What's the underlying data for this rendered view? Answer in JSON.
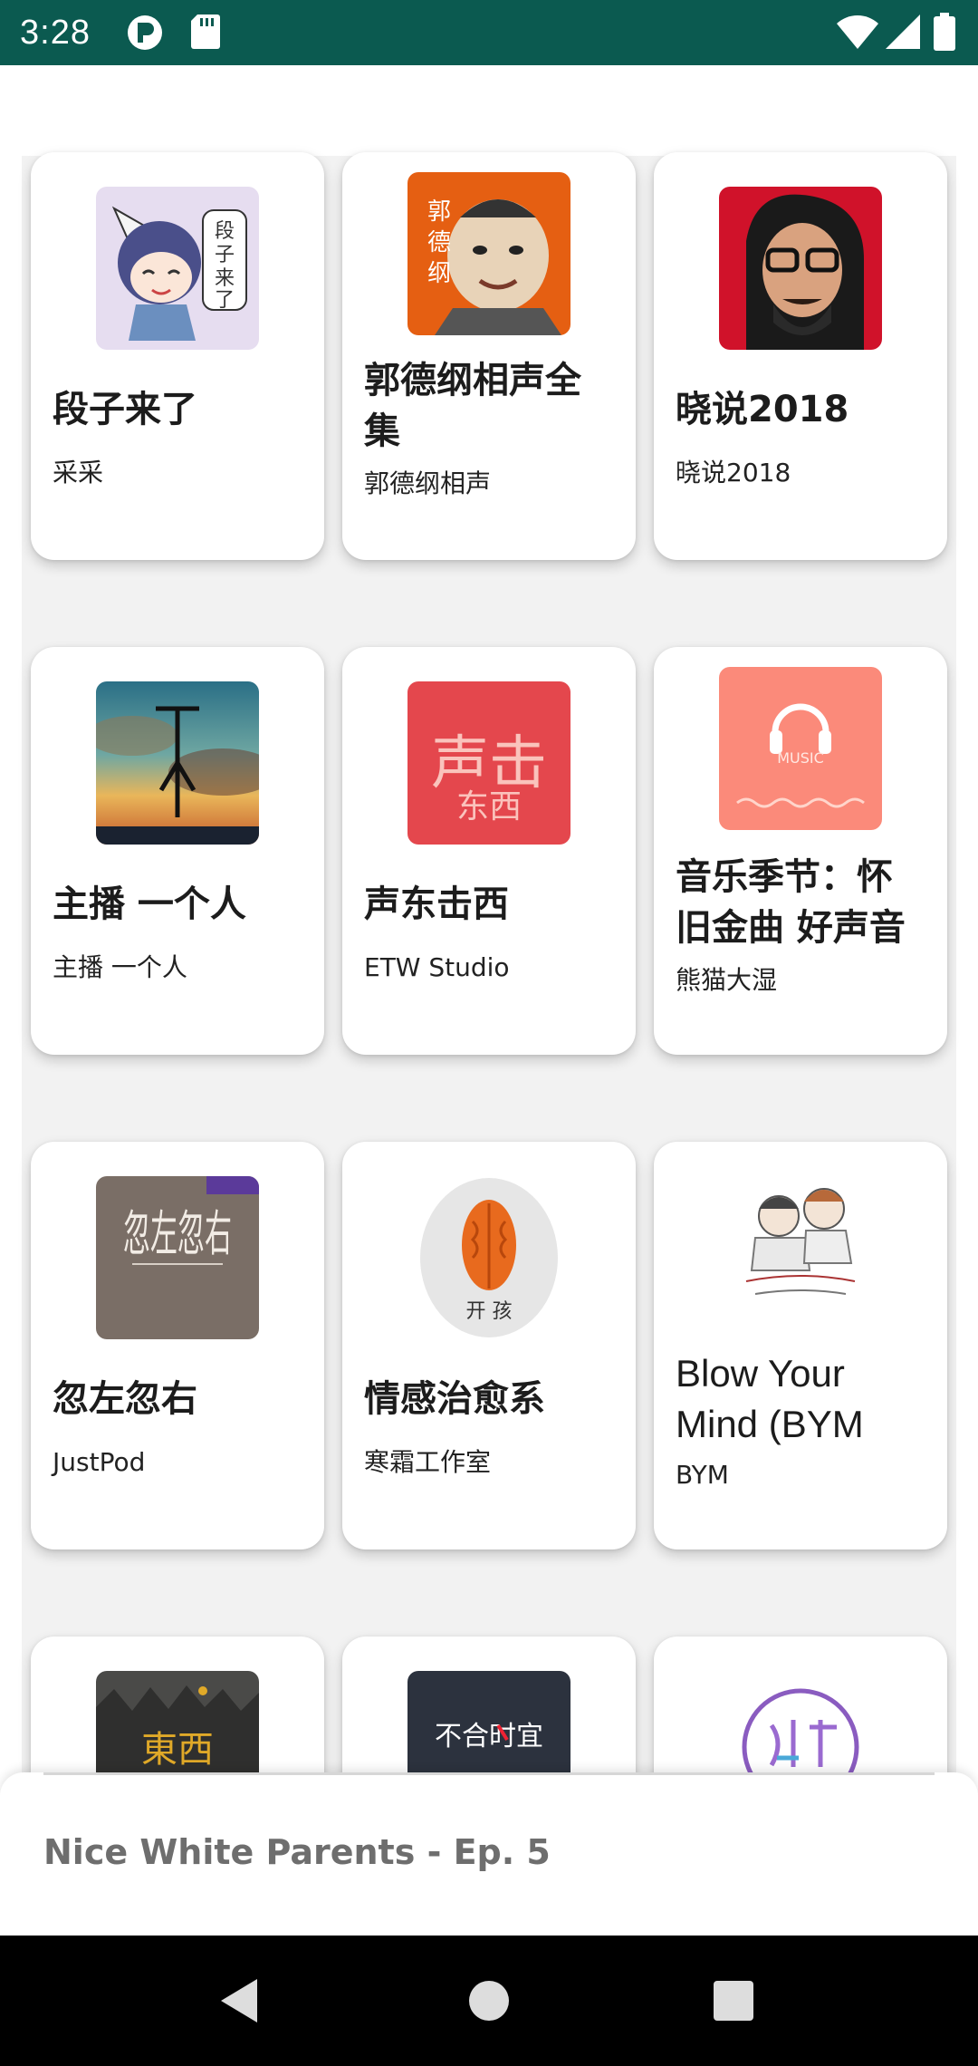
{
  "status_bar": {
    "time": "3:28"
  },
  "podcasts": [
    {
      "title": "段子来了",
      "author": "采采",
      "icon": "cartoon-girl-cover"
    },
    {
      "title": "郭德纲相声全集",
      "author": "郭德纲相声",
      "icon": "caricature-cover"
    },
    {
      "title": "晓说2018",
      "author": "晓说2018",
      "icon": "portrait-cover"
    },
    {
      "title": "主播 一个人",
      "author": "主播 一个人",
      "icon": "sky-silhouette-cover"
    },
    {
      "title": "声东击西",
      "author": "ETW Studio",
      "icon": "red-calligraphy-cover"
    },
    {
      "title": "音乐季节：怀旧金曲 好声音",
      "author": "熊猫大湿",
      "icon": "headphones-cover",
      "cover_text": "MUSIC"
    },
    {
      "title": "忽左忽右",
      "author": "JustPod",
      "icon": "grey-calligraphy-cover",
      "cover_text": "忽左忽右"
    },
    {
      "title": "情感治愈系",
      "author": "寒霜工作室",
      "icon": "walnut-cover",
      "cover_text": "开 孩"
    },
    {
      "title": "Blow Your Mind (BYM",
      "author": "BYM",
      "icon": "sketch-people-cover"
    },
    {
      "title": "",
      "author": "",
      "icon": "dark-forest-cover",
      "cover_text": "東西"
    },
    {
      "title": "",
      "author": "",
      "icon": "dark-text-cover",
      "cover_text": "不合时宜"
    },
    {
      "title": "",
      "author": "",
      "icon": "purple-ring-cover"
    }
  ],
  "mini_player": {
    "now_playing": "Nice White Parents - Ep. 5"
  },
  "nav": {
    "back": "back-icon",
    "home": "home-icon",
    "recents": "recents-icon"
  }
}
